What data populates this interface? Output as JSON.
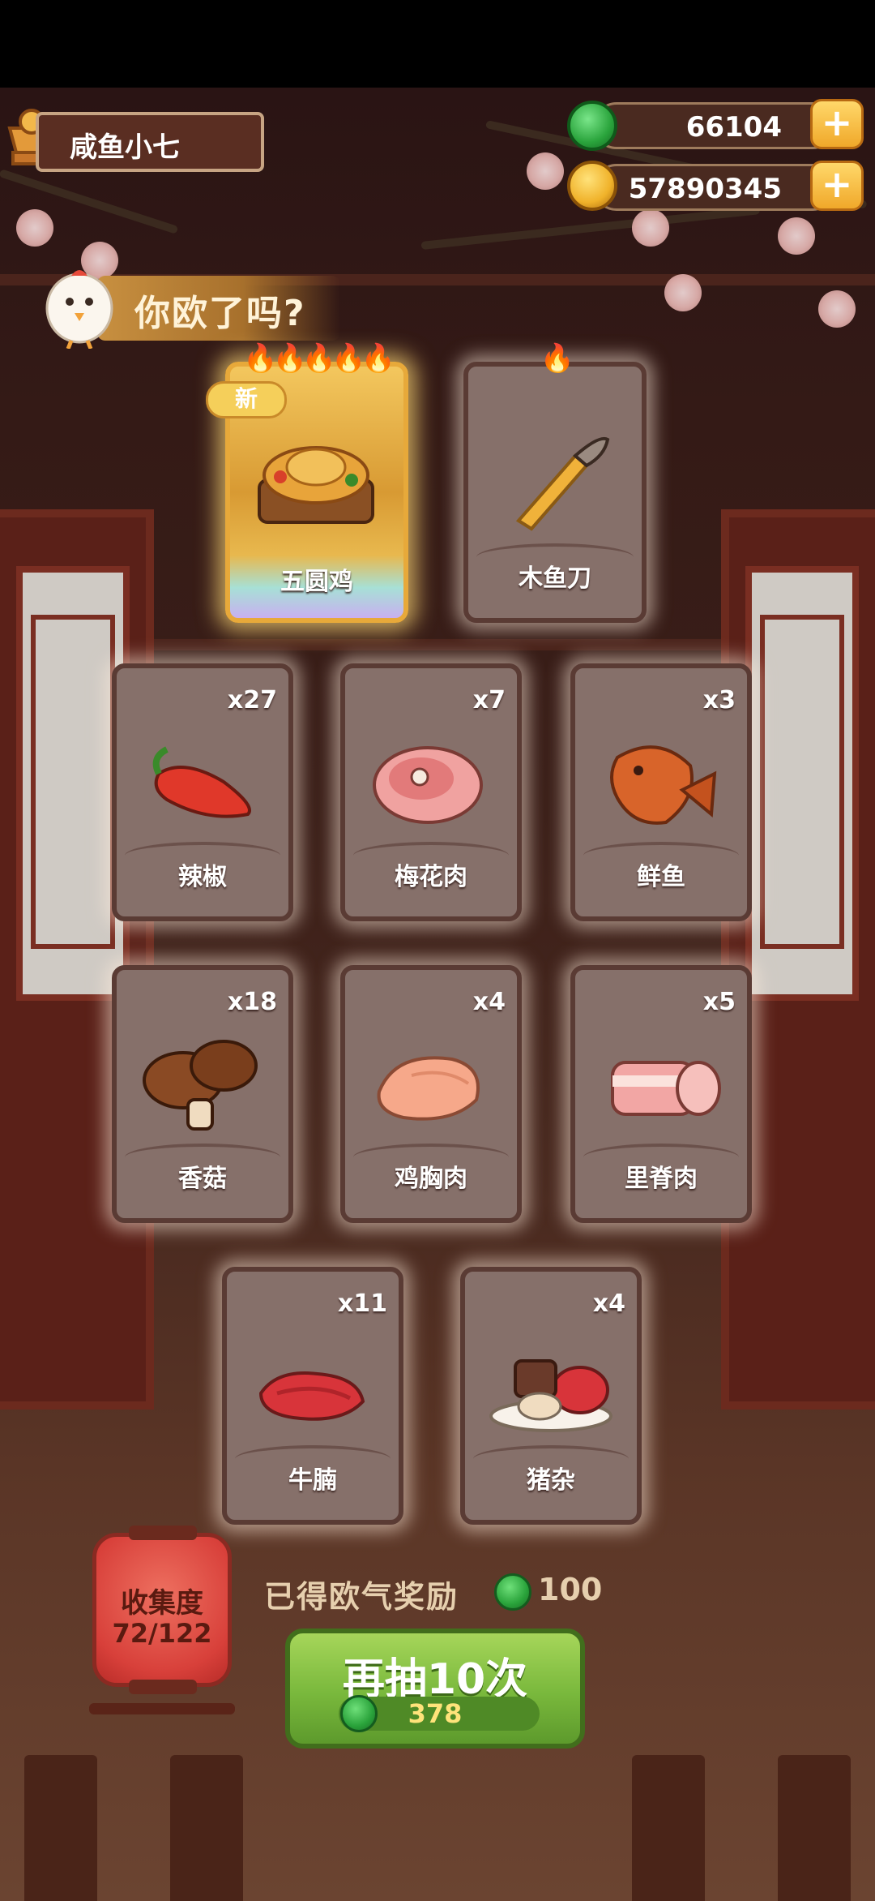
{
  "player": {
    "name": "咸鱼小七"
  },
  "currencies": {
    "jade": "66104",
    "coins": "57890345",
    "plus": "+"
  },
  "banner": {
    "title": "你欧了吗?"
  },
  "featured_cards": [
    {
      "name": "五圆鸡",
      "stars": "🔥🔥🔥🔥🔥",
      "badge": "新"
    },
    {
      "name": "木鱼刀",
      "stars": "🔥"
    }
  ],
  "cards": [
    {
      "name": "辣椒",
      "count": "x27"
    },
    {
      "name": "梅花肉",
      "count": "x7"
    },
    {
      "name": "鲜鱼",
      "count": "x3"
    },
    {
      "name": "香菇",
      "count": "x18"
    },
    {
      "name": "鸡胸肉",
      "count": "x4"
    },
    {
      "name": "里脊肉",
      "count": "x5"
    },
    {
      "name": "牛腩",
      "count": "x11"
    },
    {
      "name": "猪杂",
      "count": "x4"
    }
  ],
  "collection": {
    "label": "收集度",
    "progress": "72/122"
  },
  "reward": {
    "label": "已得欧气奖励",
    "value": "100"
  },
  "draw_button": {
    "label": "再抽10次",
    "cost": "378"
  }
}
